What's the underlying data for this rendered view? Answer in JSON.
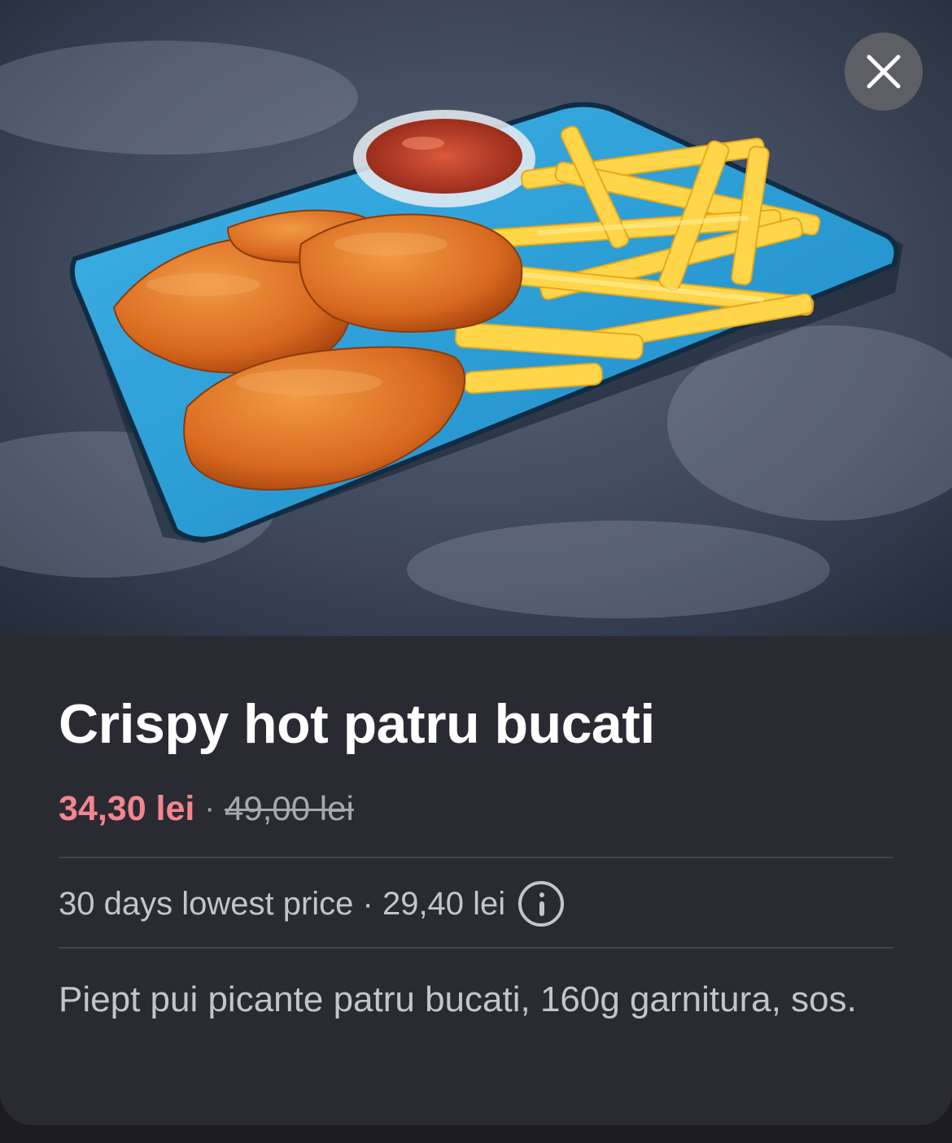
{
  "product": {
    "image_icon": "food-photo",
    "title": "Crispy hot patru bucati",
    "price_current": "34,30 lei",
    "price_separator": "·",
    "price_old": "49,00 lei",
    "lowest_price_text": "30 days lowest price · 29,40 lei",
    "description": "Piept pui picante patru bucati, 160g garnitura, sos."
  },
  "controls": {
    "close_icon": "close-icon",
    "info_icon": "info-icon"
  },
  "colors": {
    "sheet_background": "#2a2a33",
    "price_accent": "#f2868f",
    "muted_text": "#c4c4cc"
  }
}
